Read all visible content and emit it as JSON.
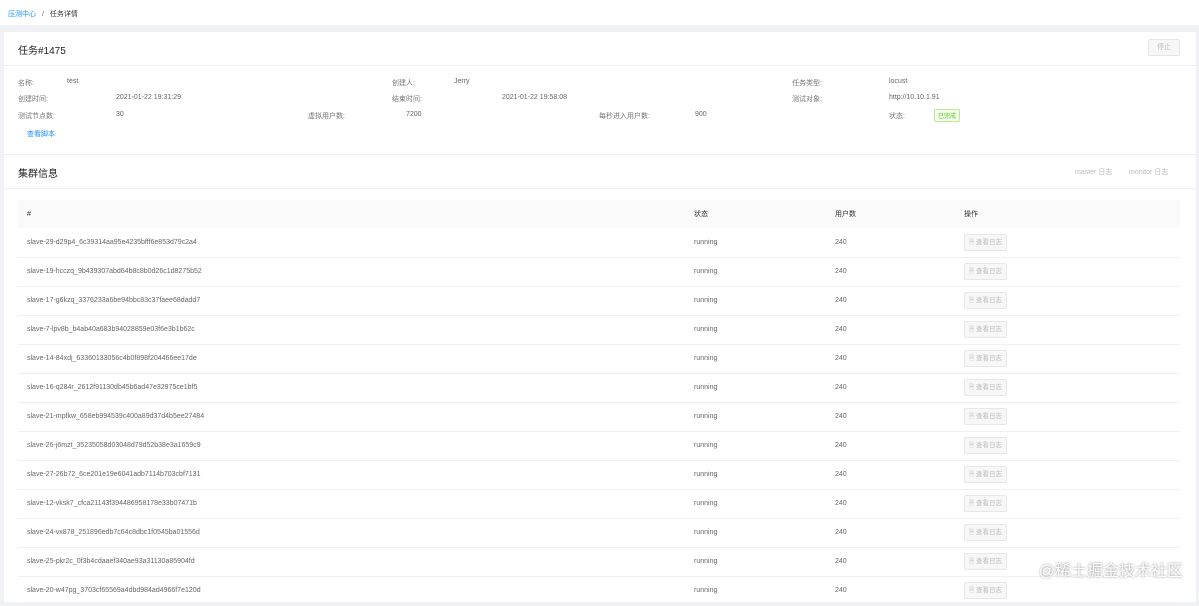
{
  "breadcrumb": {
    "parent": "压测中心",
    "separator": "/",
    "current": "任务详情"
  },
  "task": {
    "title": "任务#1475",
    "stop_label": "停止",
    "fields": {
      "name_label": "名称:",
      "name": "test",
      "creator_label": "创建人:",
      "creator": "Jerry",
      "type_label": "任务类型:",
      "type": "locust",
      "created_label": "创建时间:",
      "created": "2021-01-22 19:31:29",
      "ended_label": "结束时间:",
      "ended": "2021-01-22 19:58:08",
      "target_label": "测试对象:",
      "target": "http://10.10.1.91",
      "nodes_label": "测试节点数:",
      "nodes": "30",
      "vusers_label": "虚拟用户数:",
      "vusers": "7200",
      "rate_label": "每秒进入用户数:",
      "rate": "900",
      "status_label": "状态:",
      "status": "已完成"
    },
    "script_link": "查看脚本"
  },
  "cluster": {
    "title": "集群信息",
    "master_log": "master 日志",
    "monitor_log": "monitor 日志",
    "columns": [
      "#",
      "状态",
      "用户数",
      "操作"
    ],
    "action_label": "查看日志",
    "rows": [
      {
        "id": "slave-29-d29p4_6c39314aa95e4235bfff6e853d79c2a4",
        "status": "running",
        "users": "240"
      },
      {
        "id": "slave-19-hcczq_9b439307abd64b8c8b0d26c1d8275b52",
        "status": "running",
        "users": "240"
      },
      {
        "id": "slave-17-g6kzq_3376233a6be94bbc83c37faee68dadd7",
        "status": "running",
        "users": "240"
      },
      {
        "id": "slave-7-lpv8b_b4ab40a683b94028859e03f6e3b1b62c",
        "status": "running",
        "users": "240"
      },
      {
        "id": "slave-14-84xdj_63360133056c4b0f898f204466ee17de",
        "status": "running",
        "users": "240"
      },
      {
        "id": "slave-16-q284r_2612f91130db45b6ad47e32975ce1bf5",
        "status": "running",
        "users": "240"
      },
      {
        "id": "slave-21-mpfkw_658eb994539c400a89d37d4b5ee27484",
        "status": "running",
        "users": "240"
      },
      {
        "id": "slave-26-j6mzt_35235058d03048d79d52b38e3a1659c9",
        "status": "running",
        "users": "240"
      },
      {
        "id": "slave-27-26b72_6ce201e19e6041adb7114b703cbf7131",
        "status": "running",
        "users": "240"
      },
      {
        "id": "slave-12-vksk7_cfca21143f394486958178e33b07471b",
        "status": "running",
        "users": "240"
      },
      {
        "id": "slave-24-vx878_251896edb7c64c8dbc1f0545ba01556d",
        "status": "running",
        "users": "240"
      },
      {
        "id": "slave-25-pkr2c_0f3b4cdaaef340ae93a31130a85904fd",
        "status": "running",
        "users": "240"
      },
      {
        "id": "slave-20-w47pg_3703cf65569a4dbd984ad4966f7e120d",
        "status": "running",
        "users": "240"
      }
    ]
  },
  "watermark": "@稀土掘金技术社区"
}
